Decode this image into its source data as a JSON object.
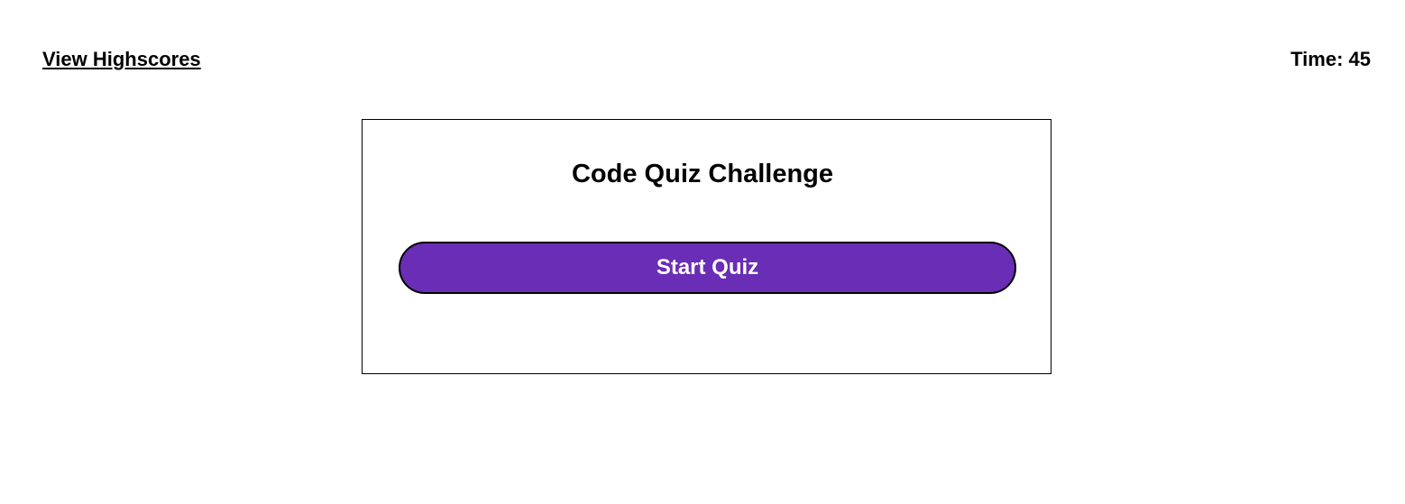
{
  "header": {
    "highscores_label": "View Highscores",
    "timer_prefix": "Time: ",
    "timer_value": "45"
  },
  "quiz": {
    "title": "Code Quiz Challenge",
    "start_label": "Start Quiz"
  },
  "colors": {
    "accent": "#6a2db5",
    "text": "#000000",
    "background": "#ffffff"
  }
}
